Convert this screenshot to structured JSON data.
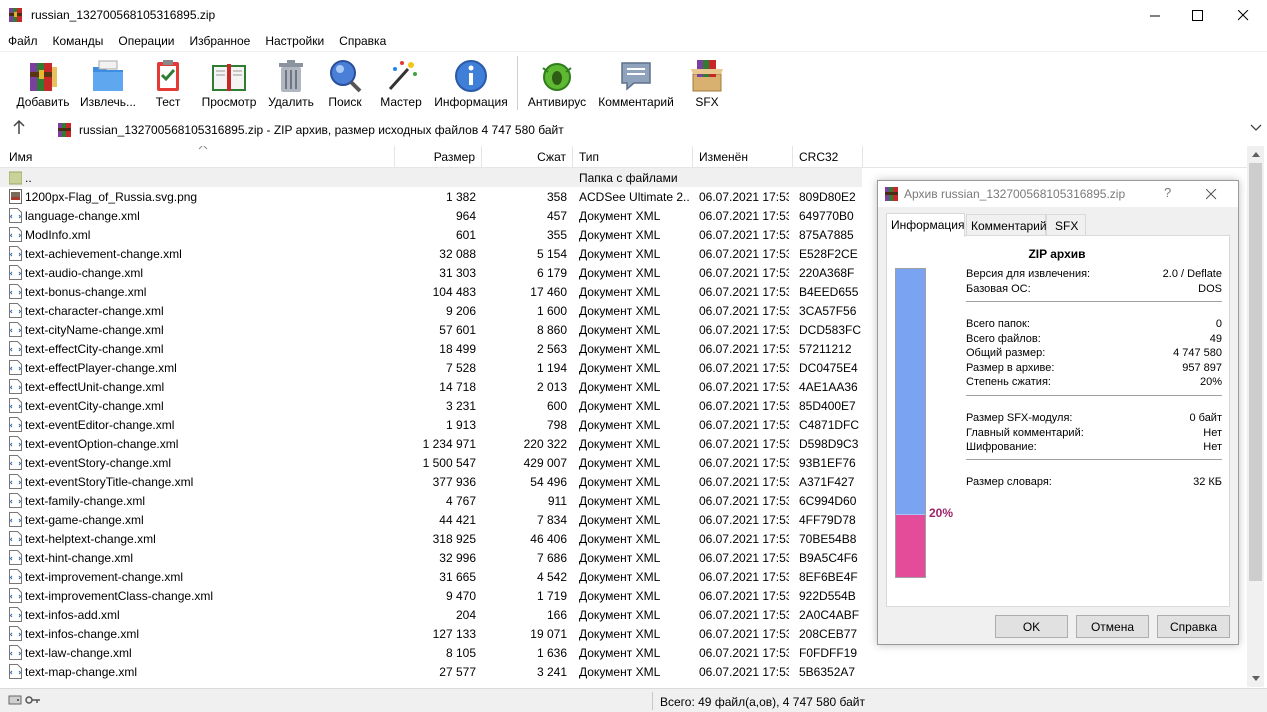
{
  "window": {
    "title": "russian_132700568105316895.zip"
  },
  "menu": [
    "Файл",
    "Команды",
    "Операции",
    "Избранное",
    "Настройки",
    "Справка"
  ],
  "toolbar": {
    "add": "Добавить",
    "extract": "Извлечь...",
    "test": "Тест",
    "view": "Просмотр",
    "delete": "Удалить",
    "find": "Поиск",
    "wizard": "Мастер",
    "info": "Информация",
    "antivirus": "Антивирус",
    "comment": "Комментарий",
    "sfx": "SFX"
  },
  "address": {
    "text": "russian_132700568105316895.zip - ZIP архив, размер исходных файлов 4 747 580 байт"
  },
  "columns": {
    "name": "Имя",
    "size": "Размер",
    "packed": "Сжат",
    "type": "Тип",
    "modified": "Изменён",
    "crc": "CRC32"
  },
  "files": [
    {
      "name": "..",
      "size": "",
      "packed": "",
      "type": "Папка с файлами",
      "modified": "",
      "crc": "",
      "icon": "folder"
    },
    {
      "name": "1200px-Flag_of_Russia.svg.png",
      "size": "1 382",
      "packed": "358",
      "type": "ACDSee Ultimate 2...",
      "modified": "06.07.2021 17:53",
      "crc": "809D80E2",
      "icon": "image"
    },
    {
      "name": "language-change.xml",
      "size": "964",
      "packed": "457",
      "type": "Документ XML",
      "modified": "06.07.2021 17:53",
      "crc": "649770B0",
      "icon": "xml"
    },
    {
      "name": "ModInfo.xml",
      "size": "601",
      "packed": "355",
      "type": "Документ XML",
      "modified": "06.07.2021 17:53",
      "crc": "875A7885",
      "icon": "xml"
    },
    {
      "name": "text-achievement-change.xml",
      "size": "32 088",
      "packed": "5 154",
      "type": "Документ XML",
      "modified": "06.07.2021 17:53",
      "crc": "E528F2CE",
      "icon": "xml"
    },
    {
      "name": "text-audio-change.xml",
      "size": "31 303",
      "packed": "6 179",
      "type": "Документ XML",
      "modified": "06.07.2021 17:53",
      "crc": "220A368F",
      "icon": "xml"
    },
    {
      "name": "text-bonus-change.xml",
      "size": "104 483",
      "packed": "17 460",
      "type": "Документ XML",
      "modified": "06.07.2021 17:53",
      "crc": "B4EED655",
      "icon": "xml"
    },
    {
      "name": "text-character-change.xml",
      "size": "9 206",
      "packed": "1 600",
      "type": "Документ XML",
      "modified": "06.07.2021 17:53",
      "crc": "3CA57F56",
      "icon": "xml"
    },
    {
      "name": "text-cityName-change.xml",
      "size": "57 601",
      "packed": "8 860",
      "type": "Документ XML",
      "modified": "06.07.2021 17:53",
      "crc": "DCD583FC",
      "icon": "xml"
    },
    {
      "name": "text-effectCity-change.xml",
      "size": "18 499",
      "packed": "2 563",
      "type": "Документ XML",
      "modified": "06.07.2021 17:53",
      "crc": "57211212",
      "icon": "xml"
    },
    {
      "name": "text-effectPlayer-change.xml",
      "size": "7 528",
      "packed": "1 194",
      "type": "Документ XML",
      "modified": "06.07.2021 17:53",
      "crc": "DC0475E4",
      "icon": "xml"
    },
    {
      "name": "text-effectUnit-change.xml",
      "size": "14 718",
      "packed": "2 013",
      "type": "Документ XML",
      "modified": "06.07.2021 17:53",
      "crc": "4AE1AA36",
      "icon": "xml"
    },
    {
      "name": "text-eventCity-change.xml",
      "size": "3 231",
      "packed": "600",
      "type": "Документ XML",
      "modified": "06.07.2021 17:53",
      "crc": "85D400E7",
      "icon": "xml"
    },
    {
      "name": "text-eventEditor-change.xml",
      "size": "1 913",
      "packed": "798",
      "type": "Документ XML",
      "modified": "06.07.2021 17:53",
      "crc": "C4871DFC",
      "icon": "xml"
    },
    {
      "name": "text-eventOption-change.xml",
      "size": "1 234 971",
      "packed": "220 322",
      "type": "Документ XML",
      "modified": "06.07.2021 17:53",
      "crc": "D598D9C3",
      "icon": "xml"
    },
    {
      "name": "text-eventStory-change.xml",
      "size": "1 500 547",
      "packed": "429 007",
      "type": "Документ XML",
      "modified": "06.07.2021 17:53",
      "crc": "93B1EF76",
      "icon": "xml"
    },
    {
      "name": "text-eventStoryTitle-change.xml",
      "size": "377 936",
      "packed": "54 496",
      "type": "Документ XML",
      "modified": "06.07.2021 17:53",
      "crc": "A371F427",
      "icon": "xml"
    },
    {
      "name": "text-family-change.xml",
      "size": "4 767",
      "packed": "911",
      "type": "Документ XML",
      "modified": "06.07.2021 17:53",
      "crc": "6C994D60",
      "icon": "xml"
    },
    {
      "name": "text-game-change.xml",
      "size": "44 421",
      "packed": "7 834",
      "type": "Документ XML",
      "modified": "06.07.2021 17:53",
      "crc": "4FF79D78",
      "icon": "xml"
    },
    {
      "name": "text-helptext-change.xml",
      "size": "318 925",
      "packed": "46 406",
      "type": "Документ XML",
      "modified": "06.07.2021 17:53",
      "crc": "70BE54B8",
      "icon": "xml"
    },
    {
      "name": "text-hint-change.xml",
      "size": "32 996",
      "packed": "7 686",
      "type": "Документ XML",
      "modified": "06.07.2021 17:53",
      "crc": "B9A5C4F6",
      "icon": "xml"
    },
    {
      "name": "text-improvement-change.xml",
      "size": "31 665",
      "packed": "4 542",
      "type": "Документ XML",
      "modified": "06.07.2021 17:53",
      "crc": "8EF6BE4F",
      "icon": "xml"
    },
    {
      "name": "text-improvementClass-change.xml",
      "size": "9 470",
      "packed": "1 719",
      "type": "Документ XML",
      "modified": "06.07.2021 17:53",
      "crc": "922D554B",
      "icon": "xml"
    },
    {
      "name": "text-infos-add.xml",
      "size": "204",
      "packed": "166",
      "type": "Документ XML",
      "modified": "06.07.2021 17:53",
      "crc": "2A0C4ABF",
      "icon": "xml"
    },
    {
      "name": "text-infos-change.xml",
      "size": "127 133",
      "packed": "19 071",
      "type": "Документ XML",
      "modified": "06.07.2021 17:53",
      "crc": "208CEB77",
      "icon": "xml"
    },
    {
      "name": "text-law-change.xml",
      "size": "8 105",
      "packed": "1 636",
      "type": "Документ XML",
      "modified": "06.07.2021 17:53",
      "crc": "F0FDFF19",
      "icon": "xml"
    },
    {
      "name": "text-map-change.xml",
      "size": "27 577",
      "packed": "3 241",
      "type": "Документ XML",
      "modified": "06.07.2021 17:53",
      "crc": "5B6352A7",
      "icon": "xml"
    }
  ],
  "status": {
    "text": "Всего: 49 файл(а,ов), 4 747 580 байт"
  },
  "dialog": {
    "title": "Архив russian_132700568105316895.zip",
    "help_glyph": "?",
    "tabs": [
      "Информация",
      "Комментарий",
      "SFX"
    ],
    "active_tab": "Информация",
    "heading": "ZIP архив",
    "ratio_label": "20%",
    "ratio_percent": 20,
    "group1": [
      {
        "k": "Версия для извлечения:",
        "v": "2.0 / Deflate"
      },
      {
        "k": "Базовая ОС:",
        "v": "DOS"
      }
    ],
    "group2": [
      {
        "k": "Всего папок:",
        "v": "0"
      },
      {
        "k": "Всего файлов:",
        "v": "49"
      },
      {
        "k": "Общий размер:",
        "v": "4 747 580"
      },
      {
        "k": "Размер в архиве:",
        "v": "957 897"
      },
      {
        "k": "Степень сжатия:",
        "v": "20%"
      }
    ],
    "group3": [
      {
        "k": "Размер SFX-модуля:",
        "v": "0 байт"
      },
      {
        "k": "Главный комментарий:",
        "v": "Нет"
      },
      {
        "k": "Шифрование:",
        "v": "Нет"
      }
    ],
    "group4": [
      {
        "k": "Размер словаря:",
        "v": "32 КБ"
      }
    ],
    "buttons": {
      "ok": "OK",
      "cancel": "Отмена",
      "help": "Справка"
    }
  },
  "colors": {
    "meter_blue": "#7aa3f2",
    "meter_pink": "#e44b98",
    "ratio_text": "#a0226a"
  }
}
